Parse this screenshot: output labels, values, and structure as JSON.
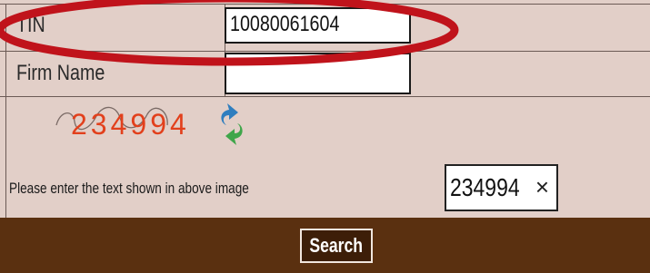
{
  "form": {
    "tin_label": "TIN",
    "tin_value": "10080061604",
    "firm_name_label": "Firm Name",
    "firm_name_value": "",
    "captcha_image_text": "234994",
    "captcha_hint": "Please enter the text shown in above image",
    "captcha_value": "234994",
    "clear_glyph": "×",
    "search_label": "Search"
  },
  "colors": {
    "background": "#e2cfc8",
    "footer": "#5a3010",
    "highlight": "#c0131b",
    "captcha_digits": "#e2401c"
  },
  "icons": [
    "refresh-icon",
    "clear-icon"
  ]
}
